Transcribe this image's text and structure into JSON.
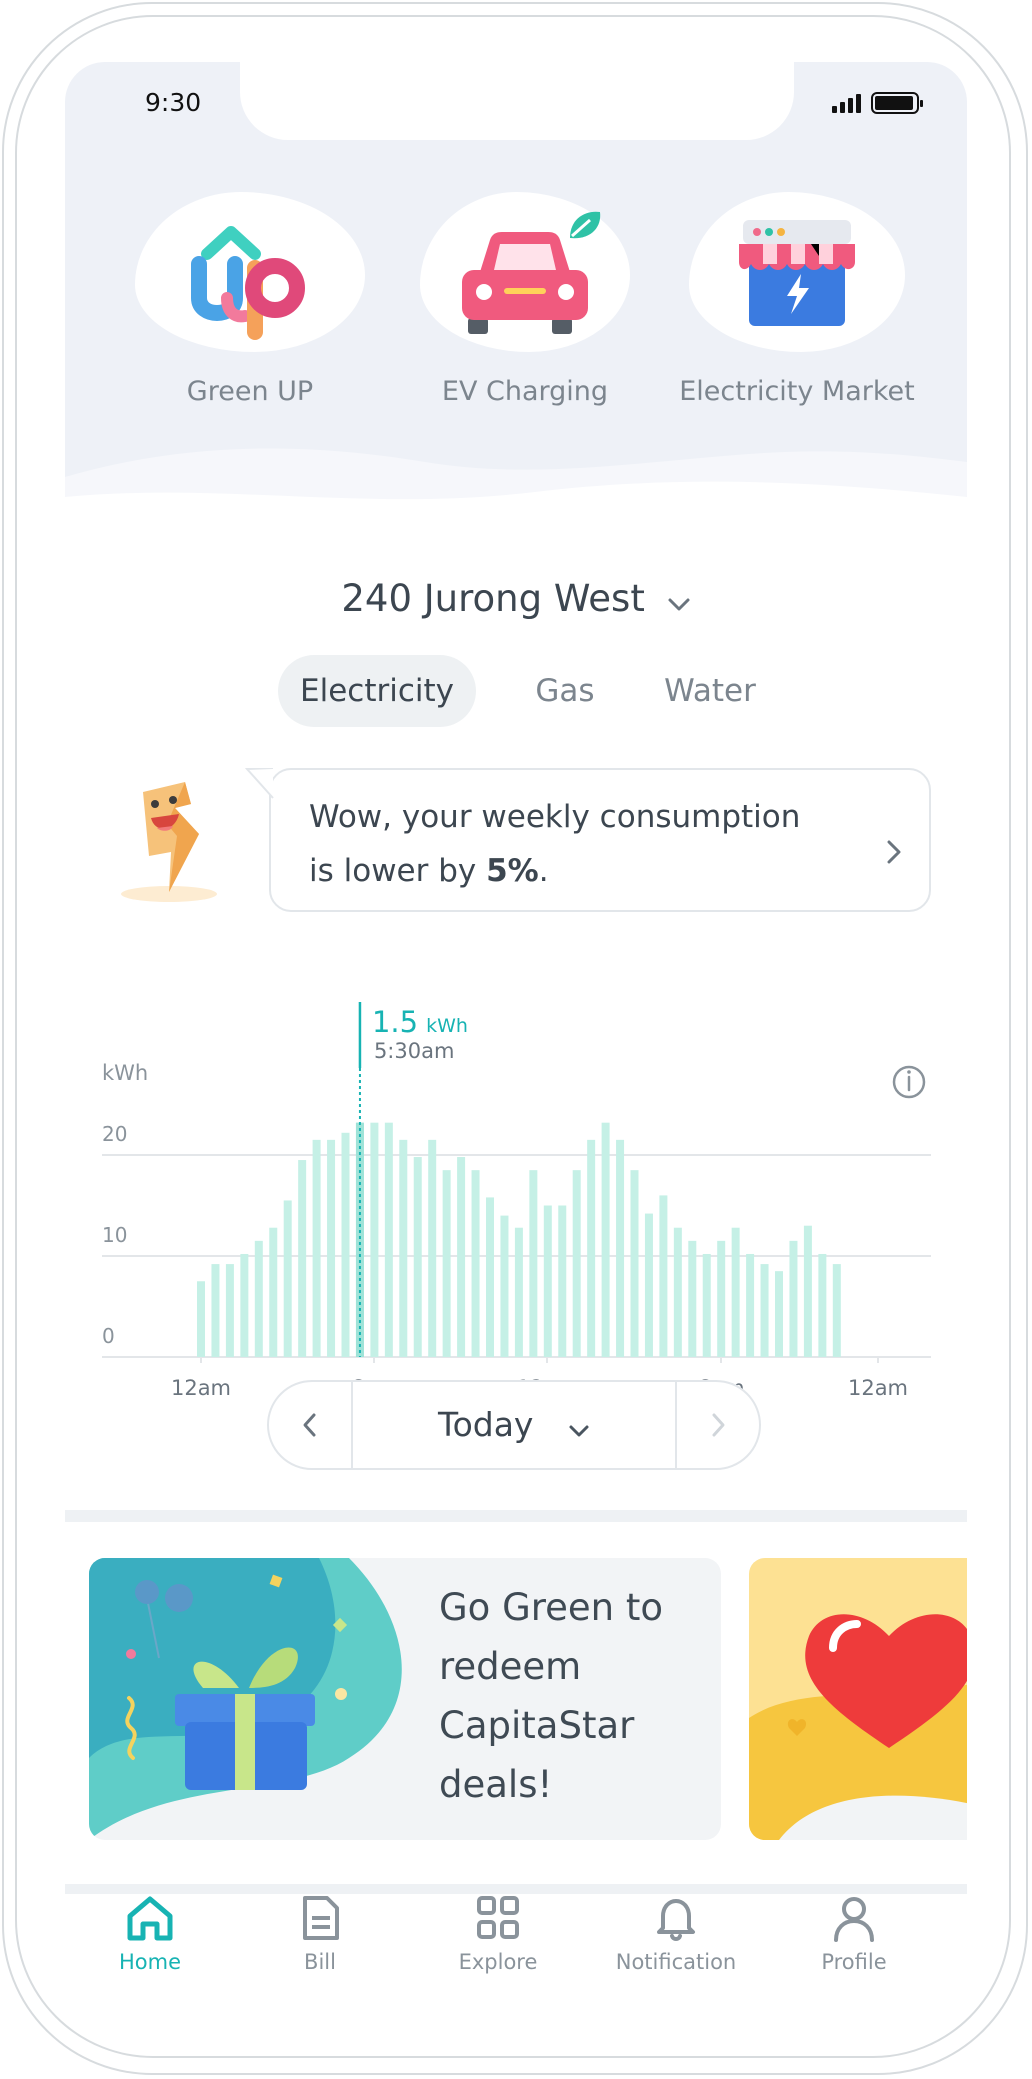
{
  "status_bar": {
    "time": "9:30"
  },
  "apps": [
    {
      "label": "Green UP",
      "icon": "green-up-icon"
    },
    {
      "label": "EV Charging",
      "icon": "ev-car-icon"
    },
    {
      "label": "Electricity Market",
      "icon": "market-store-icon"
    }
  ],
  "location": {
    "name": "240 Jurong West"
  },
  "utility_tabs": [
    {
      "label": "Electricity",
      "active": true
    },
    {
      "label": "Gas",
      "active": false
    },
    {
      "label": "Water",
      "active": false
    }
  ],
  "insight": {
    "text_before": "Wow, your weekly consumption is lower by ",
    "highlight": "5%",
    "text_after": "."
  },
  "tooltip": {
    "value": "1.5",
    "unit": "kWh",
    "time": "5:30am"
  },
  "chart_data": {
    "type": "bar",
    "ylabel": "kWh",
    "yticks": [
      "0",
      "10",
      "20"
    ],
    "ylim": [
      0,
      23
    ],
    "xticks": [
      "12am",
      "6am",
      "12pm",
      "6pm",
      "12am"
    ],
    "interval": "30 min",
    "values": [
      7.5,
      9.2,
      9.2,
      10.2,
      11.5,
      12.8,
      15.5,
      19.5,
      21.5,
      21.5,
      22.2,
      23.2,
      23.2,
      23.2,
      21.5,
      19.8,
      21.5,
      18.5,
      19.8,
      18.5,
      15.8,
      14,
      12.8,
      18.5,
      15,
      15,
      18.5,
      21.5,
      23.2,
      21.5,
      18.5,
      14.2,
      16,
      12.8,
      11.5,
      10.2,
      11.5,
      12.8,
      10.2,
      9.2,
      8.5,
      11.5,
      13,
      10.2,
      9.2
    ],
    "grid": true,
    "highlight_time": "5:30am",
    "info_icon": "info-icon",
    "bar_color": "#c5f0e6",
    "accent_color": "#17b3b3"
  },
  "date_nav": {
    "label": "Today"
  },
  "promos": [
    {
      "text": "Go Green to redeem CapitaStar deals!"
    }
  ],
  "tabbar": [
    {
      "label": "Home",
      "icon": "home-icon",
      "active": true
    },
    {
      "label": "Bill",
      "icon": "bill-icon",
      "active": false
    },
    {
      "label": "Explore",
      "icon": "explore-grid-icon",
      "active": false
    },
    {
      "label": "Notification",
      "icon": "bell-icon",
      "active": false
    },
    {
      "label": "Profile",
      "icon": "profile-icon",
      "active": false
    }
  ],
  "colors": {
    "accent": "#17b3b3",
    "hero_bg": "#eef1f7",
    "text": "#3c4650"
  }
}
